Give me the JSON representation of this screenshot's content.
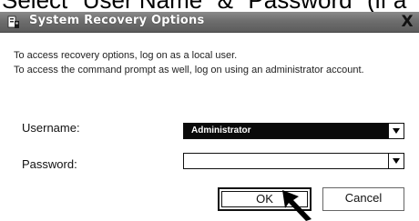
{
  "top_caption": "Select \"User Name\" & \"Password\" (if a",
  "window": {
    "title": "System Recovery Options",
    "close_glyph": "X"
  },
  "info": {
    "line1": "To access recovery options, log on as a local user.",
    "line2": "To access the command prompt as well, log on using an administrator account."
  },
  "form": {
    "username_label": "Username:",
    "username_value": "Administrator",
    "password_label": "Password:",
    "password_value": ""
  },
  "buttons": {
    "ok_label": "OK",
    "cancel_label": "Cancel"
  },
  "icons": {
    "title_icon": "system-recovery-icon",
    "dropdown_arrow": "chevron-down-icon",
    "cursor": "arrow-cursor-icon"
  }
}
